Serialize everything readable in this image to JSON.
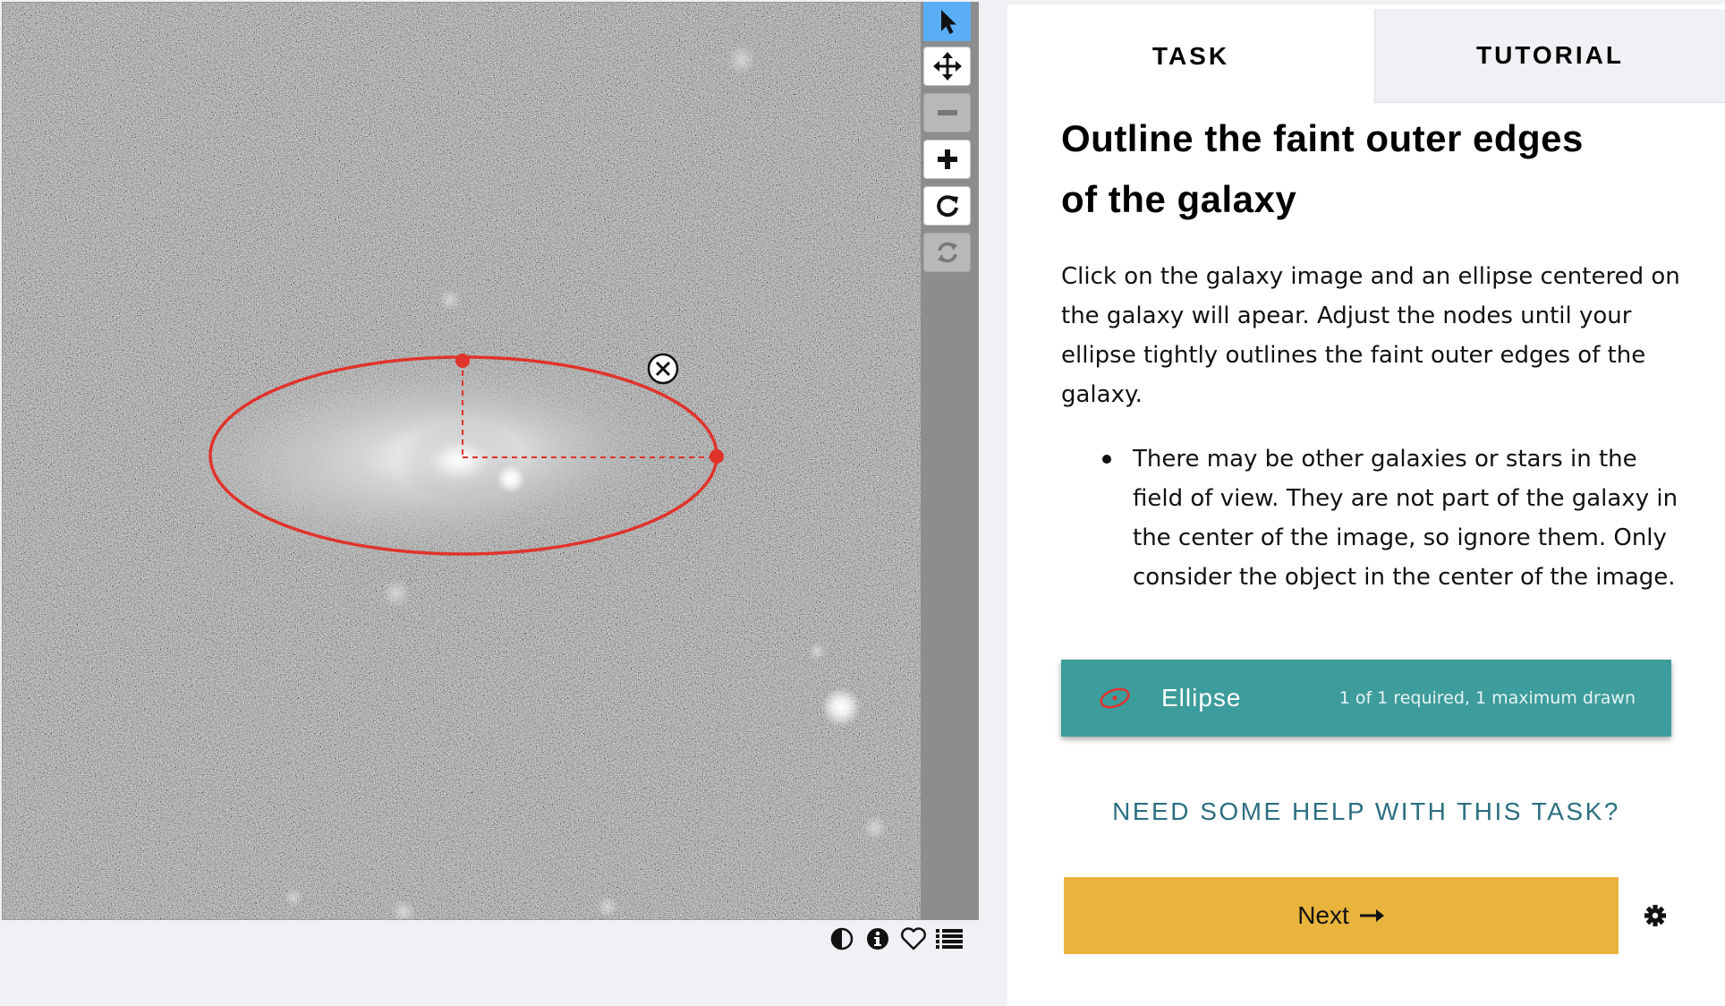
{
  "toolbar": {
    "tools": [
      {
        "icon": "pointer-icon",
        "state": "active"
      },
      {
        "icon": "move-icon",
        "state": "enabled"
      },
      {
        "icon": "zoom-out-icon",
        "state": "disabled"
      },
      {
        "icon": "zoom-in-icon",
        "state": "enabled"
      },
      {
        "icon": "rotate-icon",
        "state": "enabled"
      },
      {
        "icon": "reset-icon",
        "state": "disabled"
      }
    ]
  },
  "meta_bar": {
    "icons": [
      "contrast-icon",
      "info-icon",
      "heart-icon",
      "collections-icon"
    ]
  },
  "tabs": {
    "task": "TASK",
    "tutorial": "TUTORIAL",
    "active": "task"
  },
  "task": {
    "question_line1": "Outline the faint outer edges",
    "question_line2": "of the galaxy",
    "instructions": "Click on the galaxy image and an ellipse centered on the galaxy will apear. Adjust the nodes until your ellipse tightly outlines the faint outer edges of the galaxy.",
    "bullets": [
      "There may be other galaxies or stars in the field of view. They are not part of the galaxy in the center of the image, so ignore them. Only consider the object in the center of the image."
    ],
    "tool": {
      "label": "Ellipse",
      "count": "1 of 1 required, 1 maximum drawn",
      "icon": "ellipse-tool-icon",
      "color": "#e0332b"
    },
    "help_link": "NEED SOME HELP WITH THIS TASK?",
    "next_label": "Next"
  },
  "colors": {
    "active_tool": "#5aaef5",
    "tool_row": "#3d9c9c",
    "next_button": "#e8b43c",
    "help_link": "#2b6f80",
    "annotation": "#e0332b"
  }
}
